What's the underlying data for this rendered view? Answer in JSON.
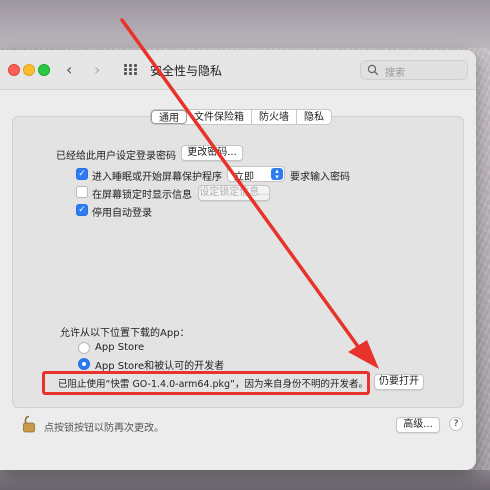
{
  "window": {
    "title": "安全性与隐私",
    "search_placeholder": "搜索"
  },
  "tabs": [
    {
      "label": "通用",
      "selected": true
    },
    {
      "label": "文件保险箱",
      "selected": false
    },
    {
      "label": "防火墙",
      "selected": false
    },
    {
      "label": "隐私",
      "selected": false
    }
  ],
  "general": {
    "login_password_label": "已经给此用户设定登录密码",
    "change_password_button": "更改密码...",
    "require_password": {
      "checked": true,
      "prefix": "进入睡眠或开始屏幕保护程序",
      "delay_value": "立即",
      "suffix": "要求输入密码"
    },
    "show_message": {
      "checked": false,
      "label": "在屏幕锁定时显示信息",
      "set_message_button": "设定锁定信息..."
    },
    "disable_auto_login": {
      "checked": true,
      "label": "停用自动登录"
    }
  },
  "downloads": {
    "heading": "允许从以下位置下载的App：",
    "options": [
      {
        "label": "App Store",
        "selected": false
      },
      {
        "label": "App Store和被认可的开发者",
        "selected": true
      }
    ],
    "blocked_message": "已阻止使用“快雷 GO-1.4.0-arm64.pkg”，因为来自身份不明的开发者。",
    "open_anyway_button": "仍要打开"
  },
  "footer": {
    "lock_text": "点按锁按钮以防再次更改。",
    "advanced_button": "高级...",
    "help_button": "?"
  },
  "colors": {
    "accent": "#2d7bf4",
    "annotation_red": "#e8322b"
  }
}
